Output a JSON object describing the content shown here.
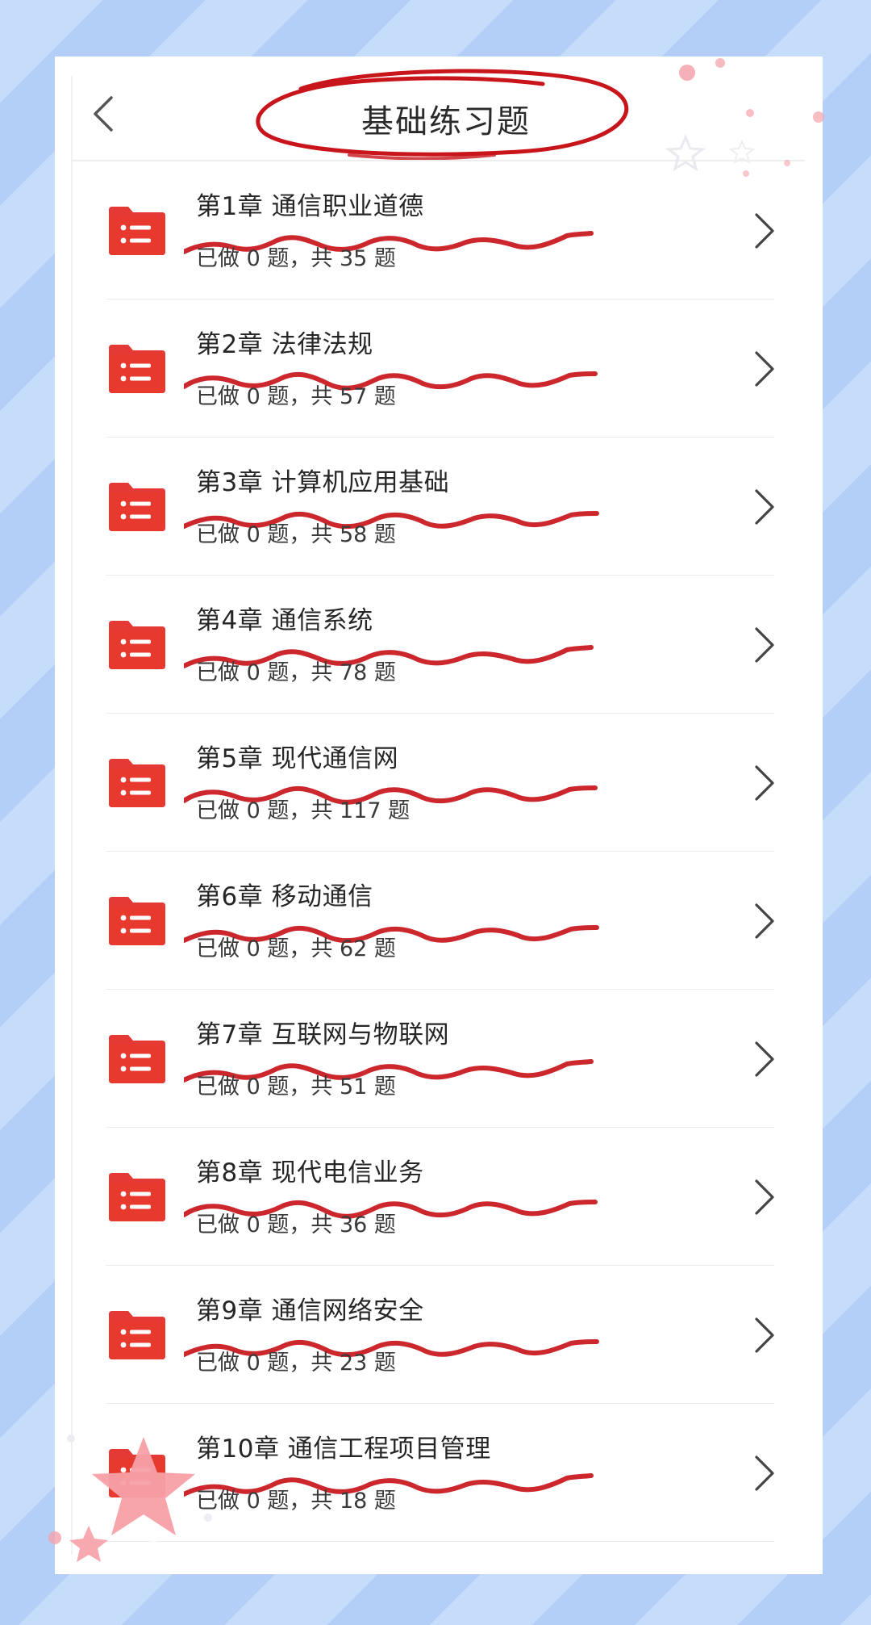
{
  "header": {
    "title": "基础练习题",
    "back_icon": "chevron-left-icon"
  },
  "colors": {
    "accent_red": "#e53935",
    "ink_red": "#c8151b",
    "background_blue": "#bcd6fa",
    "star_pink": "#f7a0a6"
  },
  "chapters": [
    {
      "title": "第1章 通信职业道德",
      "done_prefix": "已做",
      "done": "0",
      "done_unit": "题，",
      "total_prefix": "共",
      "total": "35",
      "total_unit": "题"
    },
    {
      "title": "第2章 法律法规",
      "done_prefix": "已做",
      "done": "0",
      "done_unit": "题，",
      "total_prefix": "共",
      "total": "57",
      "total_unit": "题"
    },
    {
      "title": "第3章 计算机应用基础",
      "done_prefix": "已做",
      "done": "0",
      "done_unit": "题，",
      "total_prefix": "共",
      "total": "58",
      "total_unit": "题"
    },
    {
      "title": "第4章 通信系统",
      "done_prefix": "已做",
      "done": "0",
      "done_unit": "题，",
      "total_prefix": "共",
      "total": "78",
      "total_unit": "题"
    },
    {
      "title": "第5章 现代通信网",
      "done_prefix": "已做",
      "done": "0",
      "done_unit": "题，",
      "total_prefix": "共",
      "total": "117",
      "total_unit": "题"
    },
    {
      "title": "第6章 移动通信",
      "done_prefix": "已做",
      "done": "0",
      "done_unit": "题，",
      "total_prefix": "共",
      "total": "62",
      "total_unit": "题"
    },
    {
      "title": "第7章 互联网与物联网",
      "done_prefix": "已做",
      "done": "0",
      "done_unit": "题，",
      "total_prefix": "共",
      "total": "51",
      "total_unit": "题"
    },
    {
      "title": "第8章 现代电信业务",
      "done_prefix": "已做",
      "done": "0",
      "done_unit": "题，",
      "total_prefix": "共",
      "total": "36",
      "total_unit": "题"
    },
    {
      "title": "第9章 通信网络安全",
      "done_prefix": "已做",
      "done": "0",
      "done_unit": "题，",
      "total_prefix": "共",
      "total": "23",
      "total_unit": "题"
    },
    {
      "title": "第10章 通信工程项目管理",
      "done_prefix": "已做",
      "done": "0",
      "done_unit": "题，",
      "total_prefix": "共",
      "total": "18",
      "total_unit": "题"
    }
  ],
  "icons": {
    "row_icon": "folder-list-icon",
    "row_arrow": "chevron-right-icon"
  }
}
